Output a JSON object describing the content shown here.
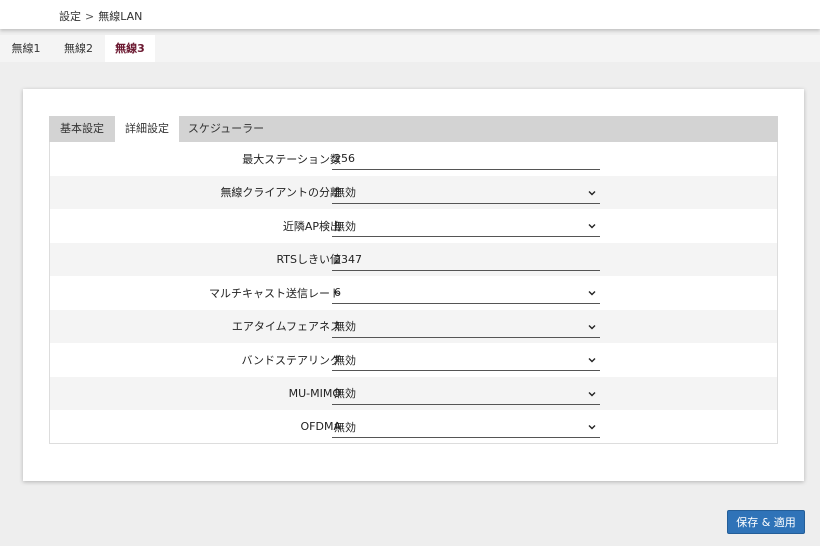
{
  "breadcrumb": {
    "parent": "設定",
    "separator": ">",
    "current": "無線LAN"
  },
  "wireless_tabs": [
    {
      "label": "無線1",
      "active": false
    },
    {
      "label": "無線2",
      "active": false
    },
    {
      "label": "無線3",
      "active": true
    }
  ],
  "settings_tabs": [
    {
      "label": "基本設定",
      "active": false
    },
    {
      "label": "詳細設定",
      "active": true
    },
    {
      "label": "スケジューラー",
      "active": false
    }
  ],
  "fields": [
    {
      "label": "最大ステーション数",
      "type": "text",
      "value": "256"
    },
    {
      "label": "無線クライアントの分離",
      "type": "select",
      "value": "無効"
    },
    {
      "label": "近隣AP検出",
      "type": "select",
      "value": "無効"
    },
    {
      "label": "RTSしきい値",
      "type": "text",
      "value": "2347"
    },
    {
      "label": "マルチキャスト送信レート",
      "type": "select",
      "value": "6"
    },
    {
      "label": "エアタイムフェアネス",
      "type": "select",
      "value": "無効"
    },
    {
      "label": "バンドステアリング",
      "type": "select",
      "value": "無効"
    },
    {
      "label": "MU-MIMO",
      "type": "select",
      "value": "無効"
    },
    {
      "label": "OFDMA",
      "type": "select",
      "value": "無効"
    }
  ],
  "actions": {
    "save_label": "保存 & 適用"
  },
  "colors": {
    "active_tab_text": "#6b1830",
    "primary_button": "#2f73b8"
  }
}
